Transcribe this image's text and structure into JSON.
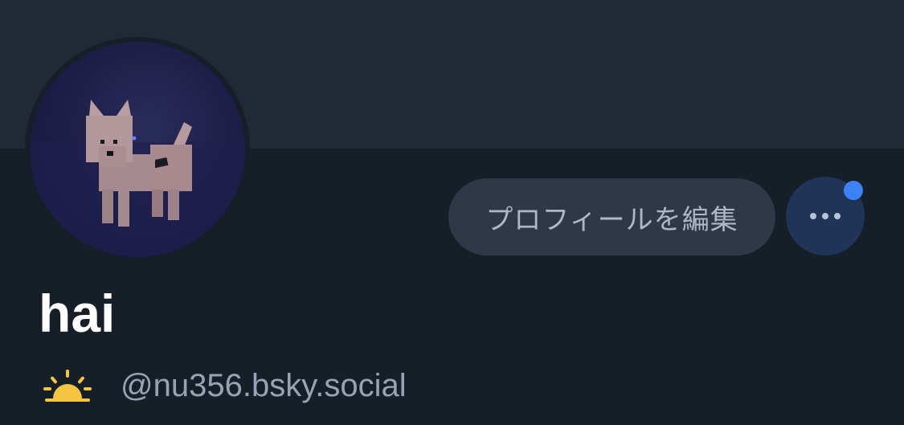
{
  "profile": {
    "display_name": "hai",
    "handle": "@nu356.bsky.social",
    "avatar_description": "avatar-image",
    "status_emoji_icon": "sunrise-icon"
  },
  "actions": {
    "edit_profile_label": "プロフィールを編集",
    "more_icon": "ellipsis-icon",
    "notification_badge_color": "#3b82f6"
  },
  "colors": {
    "background": "#161e27",
    "banner": "#212936",
    "edit_button_bg": "#2e3847",
    "more_button_bg": "#203457",
    "name_text": "#ffffff",
    "handle_text": "#98a2b3",
    "accent_yellow": "#f5c542"
  }
}
